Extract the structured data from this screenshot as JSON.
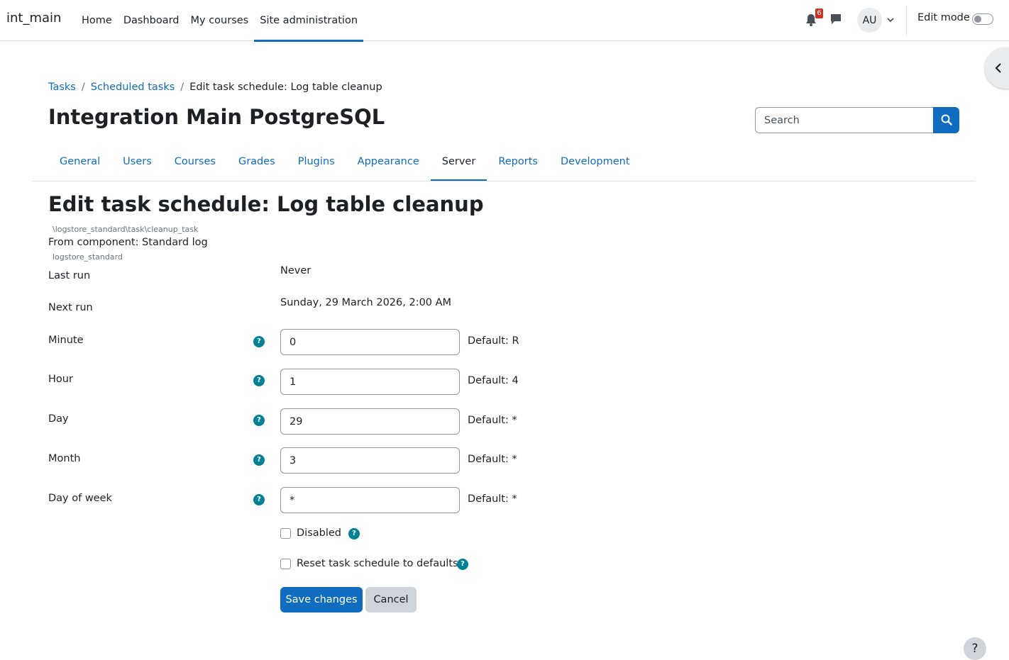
{
  "brand": "int_main",
  "primary_nav": [
    {
      "label": "Home"
    },
    {
      "label": "Dashboard"
    },
    {
      "label": "My courses"
    },
    {
      "label": "Site administration"
    }
  ],
  "notifications": {
    "icon": "bell-icon",
    "count": "6"
  },
  "messages": {
    "icon": "chat-icon"
  },
  "user": {
    "initials": "AU",
    "caret_icon": "chevron-down-icon"
  },
  "edit_mode": {
    "label": "Edit mode",
    "on": false
  },
  "breadcrumb": [
    {
      "label": "Tasks"
    },
    {
      "label": "Scheduled tasks"
    },
    {
      "label": "Edit task schedule: Log table cleanup"
    }
  ],
  "breadcrumb_separator": "/",
  "site_title": "Integration Main PostgreSQL",
  "search": {
    "placeholder": "Search",
    "icon": "search-icon"
  },
  "secondary_nav": [
    {
      "label": "General"
    },
    {
      "label": "Users"
    },
    {
      "label": "Courses"
    },
    {
      "label": "Grades"
    },
    {
      "label": "Plugins"
    },
    {
      "label": "Appearance"
    },
    {
      "label": "Server"
    },
    {
      "label": "Reports"
    },
    {
      "label": "Development"
    }
  ],
  "active_secondary_tab": "Server",
  "page_heading": "Edit task schedule: Log table cleanup",
  "task_class": "\\logstore_standard\\task\\cleanup_task",
  "component_line": "From component: Standard log",
  "component_code": "logstore_standard",
  "last_run": {
    "label": "Last run",
    "value": "Never"
  },
  "next_run": {
    "label": "Next run",
    "value": "Sunday, 29 March 2026, 2:00 AM"
  },
  "fields": {
    "minute": {
      "label": "Minute",
      "value": "0",
      "default": "Default: R"
    },
    "hour": {
      "label": "Hour",
      "value": "1",
      "default": "Default: 4"
    },
    "day": {
      "label": "Day",
      "value": "29",
      "default": "Default: *"
    },
    "month": {
      "label": "Month",
      "value": "3",
      "default": "Default: *"
    },
    "dayofweek": {
      "label": "Day of week",
      "value": "*",
      "default": "Default: *"
    }
  },
  "help_glyph": "?",
  "checkboxes": {
    "disabled": {
      "label": "Disabled",
      "checked": false
    },
    "reset": {
      "label": "Reset task schedule to defaults",
      "checked": false
    }
  },
  "buttons": {
    "save": "Save changes",
    "cancel": "Cancel"
  },
  "footer_help": "?",
  "colors": {
    "primary": "#0f6cbf",
    "help": "#008196",
    "badge": "#ca3120",
    "text": "#1d2125"
  }
}
